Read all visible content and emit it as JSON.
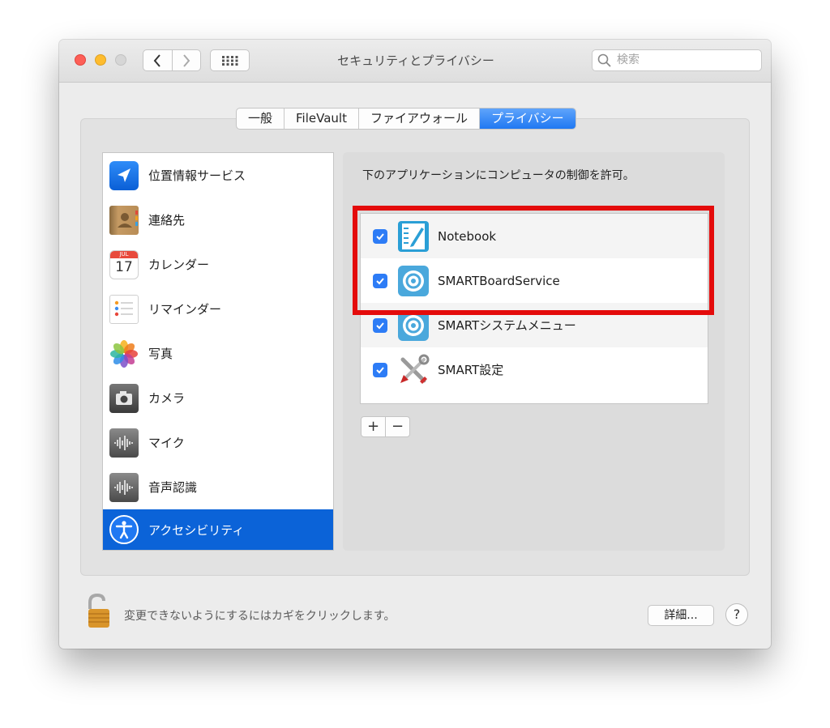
{
  "window": {
    "title": "セキュリティとプライバシー",
    "search_placeholder": "検索"
  },
  "tabs": [
    {
      "label": "一般",
      "active": false
    },
    {
      "label": "FileVault",
      "active": false
    },
    {
      "label": "ファイアウォール",
      "active": false
    },
    {
      "label": "プライバシー",
      "active": true
    }
  ],
  "sidebar": {
    "items": [
      {
        "label": "位置情報サービス",
        "icon": "location-arrow-icon"
      },
      {
        "label": "連絡先",
        "icon": "contacts-book-icon"
      },
      {
        "label": "カレンダー",
        "icon": "calendar-icon",
        "icon_month": "JUL",
        "icon_day": "17"
      },
      {
        "label": "リマインダー",
        "icon": "reminders-list-icon"
      },
      {
        "label": "写真",
        "icon": "photos-flower-icon"
      },
      {
        "label": "カメラ",
        "icon": "camera-icon"
      },
      {
        "label": "マイク",
        "icon": "microphone-waveform-icon"
      },
      {
        "label": "音声認識",
        "icon": "speech-waveform-icon"
      },
      {
        "label": "アクセシビリティ",
        "icon": "accessibility-person-icon",
        "selected": true
      }
    ]
  },
  "main": {
    "description": "下のアプリケーションにコンピュータの制御を許可。",
    "apps": [
      {
        "name": "Notebook",
        "checked": true,
        "icon": "notebook-app-icon"
      },
      {
        "name": "SMARTBoardService",
        "checked": true,
        "icon": "smart-board-service-icon"
      },
      {
        "name": "SMARTシステムメニュー",
        "checked": true,
        "icon": "smart-system-menu-icon"
      },
      {
        "name": "SMART設定",
        "checked": true,
        "icon": "smart-settings-tools-icon"
      }
    ],
    "add_label": "+",
    "remove_label": "−"
  },
  "footer": {
    "lock_text": "変更できないようにするにはカギをクリックします。",
    "detail_button": "詳細...",
    "help_button": "?"
  },
  "colors": {
    "accent": "#1f78f2",
    "selection": "#0b63d8",
    "highlight": "#e40b0b"
  }
}
